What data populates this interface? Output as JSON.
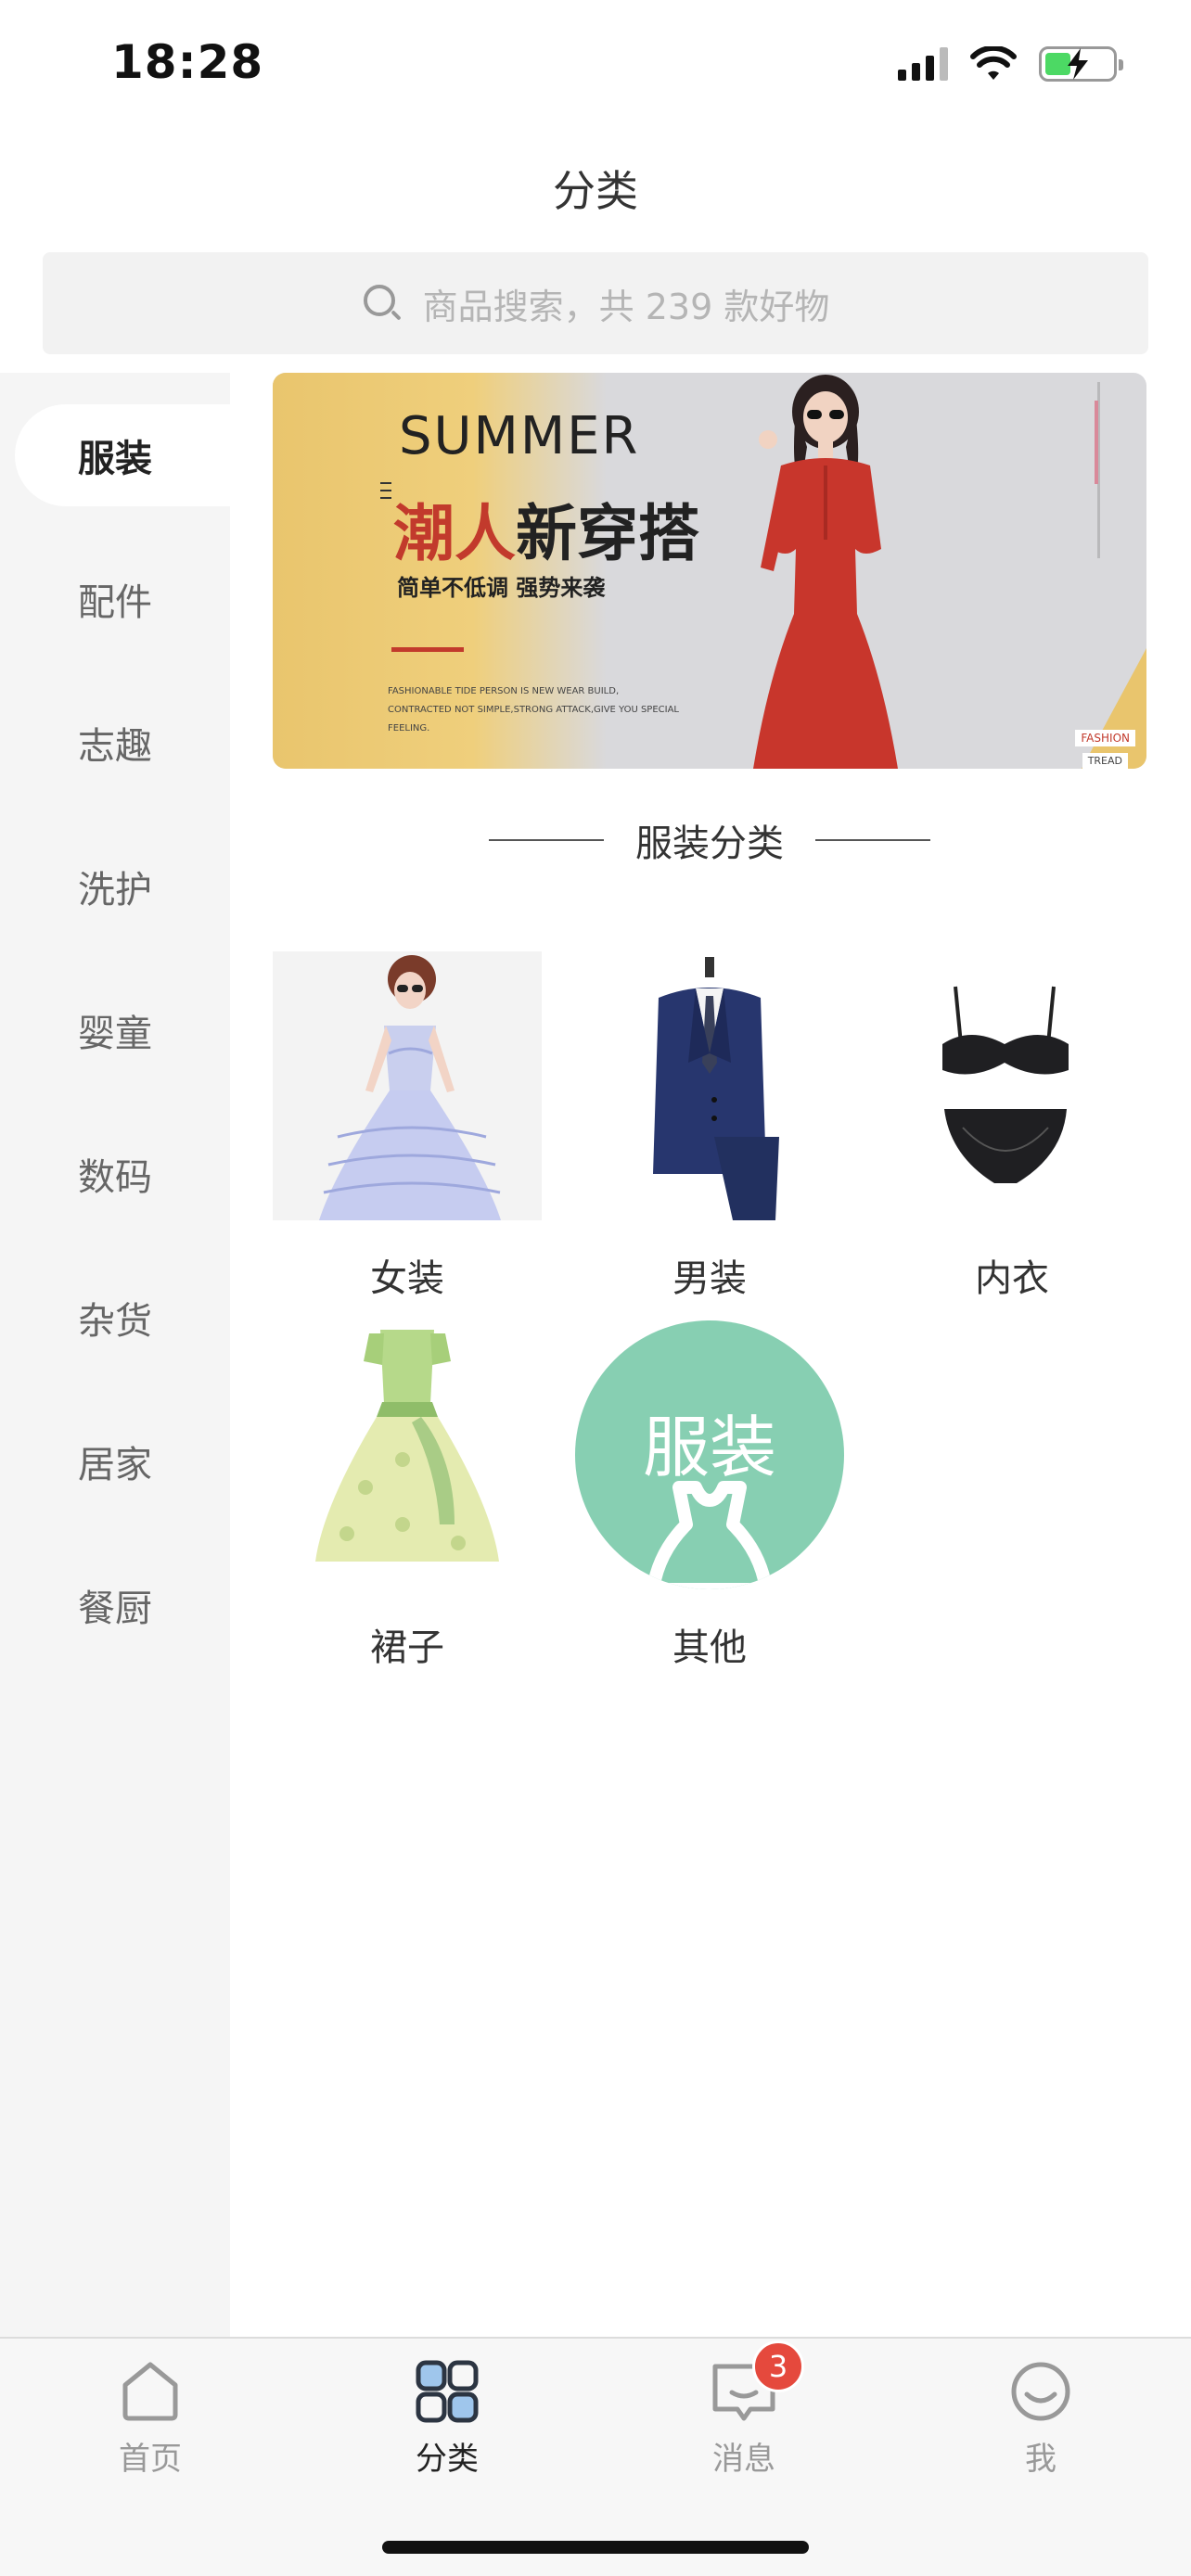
{
  "status_bar": {
    "time": "18:28"
  },
  "header": {
    "title": "分类"
  },
  "search": {
    "placeholder": "商品搜索，共 239 款好物"
  },
  "sidebar": {
    "items": [
      {
        "label": "服装",
        "active": true
      },
      {
        "label": "配件",
        "active": false
      },
      {
        "label": "志趣",
        "active": false
      },
      {
        "label": "洗护",
        "active": false
      },
      {
        "label": "婴童",
        "active": false
      },
      {
        "label": "数码",
        "active": false
      },
      {
        "label": "杂货",
        "active": false
      },
      {
        "label": "居家",
        "active": false
      },
      {
        "label": "餐厨",
        "active": false
      }
    ]
  },
  "banner": {
    "summer": "SUMMER",
    "headline_red": "潮人",
    "headline_black": "新穿搭",
    "subline": "简单不低调  强势来袭",
    "fine_print_1": "FASHIONABLE TIDE PERSON IS NEW WEAR BUILD,",
    "fine_print_2": "CONTRACTED NOT SIMPLE,STRONG ATTACK,GIVE YOU SPECIAL FEELING.",
    "tag_fashion": "FASHION",
    "tag_tread": "TREAD"
  },
  "section": {
    "title": "服装分类"
  },
  "categories": [
    {
      "label": "女装",
      "icon": "dress-model-image"
    },
    {
      "label": "男装",
      "icon": "suit-image"
    },
    {
      "label": "内衣",
      "icon": "lingerie-image"
    },
    {
      "label": "裙子",
      "icon": "skirt-dress-image"
    },
    {
      "label": "其他",
      "icon": "other-clothing-icon",
      "thumb_text": "服装"
    }
  ],
  "tab_bar": {
    "tabs": [
      {
        "label": "首页",
        "icon": "home-icon",
        "active": false
      },
      {
        "label": "分类",
        "icon": "category-grid-icon",
        "active": true
      },
      {
        "label": "消息",
        "icon": "message-icon",
        "active": false,
        "badge": "3"
      },
      {
        "label": "我",
        "icon": "profile-smile-icon",
        "active": false
      }
    ]
  },
  "colors": {
    "accent_red": "#c23a2c",
    "badge_red": "#e5493d",
    "other_green": "#87cfb2",
    "banner_gold": "#e9c56d"
  }
}
